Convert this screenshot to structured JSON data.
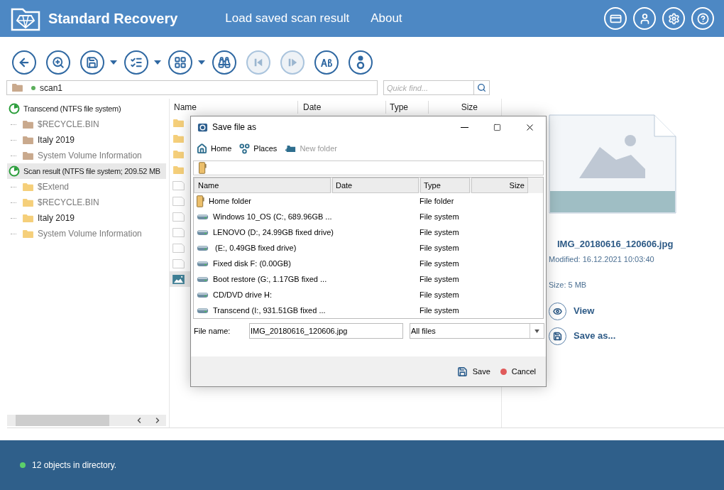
{
  "app": {
    "title": "Standard Recovery",
    "nav": [
      "Load saved scan result",
      "About"
    ]
  },
  "toolbar": [
    {
      "kind": "back",
      "dropdown": false,
      "disabled": false
    },
    {
      "kind": "scan",
      "dropdown": false,
      "disabled": false
    },
    {
      "kind": "save",
      "dropdown": true,
      "disabled": false
    },
    {
      "kind": "checklist",
      "dropdown": true,
      "disabled": false
    },
    {
      "kind": "view",
      "dropdown": true,
      "disabled": false
    },
    {
      "kind": "find",
      "dropdown": false,
      "disabled": false
    },
    {
      "kind": "prev",
      "dropdown": false,
      "disabled": true
    },
    {
      "kind": "next",
      "dropdown": false,
      "disabled": true
    },
    {
      "kind": "case",
      "dropdown": false,
      "disabled": false
    },
    {
      "kind": "info",
      "dropdown": false,
      "disabled": false
    }
  ],
  "path": {
    "value": "scan1"
  },
  "quick_find": {
    "placeholder": "Quick find..."
  },
  "tree": [
    {
      "label": "Transcend (NTFS file system)",
      "kind": "source",
      "selected": false,
      "children": [
        {
          "label": "$RECYCLE.BIN",
          "muted": true
        },
        {
          "label": "Italy 2019",
          "muted": false
        },
        {
          "label": "System Volume Information",
          "muted": true
        }
      ]
    },
    {
      "label": "Scan result (NTFS file system; 209.52 MB",
      "kind": "scan",
      "selected": true,
      "children": [
        {
          "label": "$Extend",
          "muted": true
        },
        {
          "label": "$RECYCLE.BIN",
          "muted": true
        },
        {
          "label": "Italy 2019",
          "muted": false
        },
        {
          "label": "System Volume Information",
          "muted": true
        }
      ]
    }
  ],
  "file_list": {
    "columns": [
      "Name",
      "Date",
      "Type",
      "Size"
    ],
    "rows": [
      {
        "kind": "folder",
        "selected": false
      },
      {
        "kind": "folder",
        "selected": false
      },
      {
        "kind": "folder",
        "selected": false
      },
      {
        "kind": "folder",
        "selected": false
      },
      {
        "kind": "file",
        "selected": false
      },
      {
        "kind": "file",
        "selected": false
      },
      {
        "kind": "file",
        "selected": false
      },
      {
        "kind": "file",
        "selected": false
      },
      {
        "kind": "file",
        "selected": false
      },
      {
        "kind": "file",
        "selected": false
      },
      {
        "kind": "image",
        "selected": true
      }
    ]
  },
  "preview": {
    "file": "IMG_20180616_120606.jpg",
    "modified": "Modified: 16.12.2021 10:03:40",
    "size": "Size: 5 MB",
    "actions": [
      {
        "label": "View",
        "kind": "view"
      },
      {
        "label": "Save as...",
        "kind": "save"
      }
    ]
  },
  "status_bar": {
    "text": "12 objects in directory."
  },
  "dialog": {
    "title": "Save file as",
    "toolbar": [
      {
        "label": "Home",
        "kind": "home",
        "disabled": false
      },
      {
        "label": "Places",
        "kind": "places",
        "disabled": false
      },
      {
        "label": "New folder",
        "kind": "new_folder",
        "disabled": true
      }
    ],
    "columns": [
      "Name",
      "Date",
      "Type",
      "Size"
    ],
    "rows": [
      {
        "name": "Home folder",
        "type": "File folder",
        "kind": "folder"
      },
      {
        "name": "Windows 10_OS (C:, 689.96GB ...",
        "type": "File system",
        "kind": "drive"
      },
      {
        "name": "LENOVO (D:, 24.99GB fixed drive)",
        "type": "File system",
        "kind": "drive"
      },
      {
        "name": " (E:, 0.49GB fixed drive)",
        "type": "File system",
        "kind": "drive"
      },
      {
        "name": "Fixed disk F: (0.00GB)",
        "type": "File system",
        "kind": "drive"
      },
      {
        "name": "Boot restore (G:, 1.17GB fixed ...",
        "type": "File system",
        "kind": "drive"
      },
      {
        "name": "CD/DVD drive H:",
        "type": "File system",
        "kind": "drive"
      },
      {
        "name": "Transcend (I:, 931.51GB fixed ...",
        "type": "File system",
        "kind": "drive"
      }
    ],
    "file_name_label": "File name:",
    "file_name": "IMG_20180616_120606.jpg",
    "filter": "All files",
    "buttons": [
      {
        "label": "Save",
        "kind": "save"
      },
      {
        "label": "Cancel",
        "kind": "cancel"
      }
    ]
  }
}
